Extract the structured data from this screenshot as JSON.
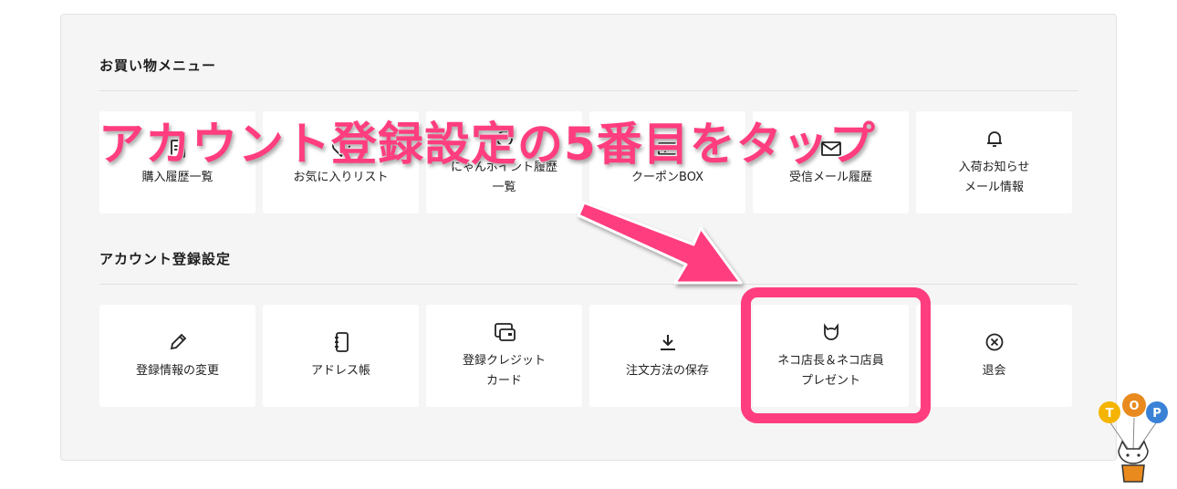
{
  "shopping_menu": {
    "title": "お買い物メニュー",
    "items": [
      {
        "label": "購入履歴一覧",
        "icon": "receipt-icon"
      },
      {
        "label": "お気に入りリスト",
        "icon": "heart-icon"
      },
      {
        "label": "にゃんポイント履歴\n一覧",
        "icon": "coin-icon"
      },
      {
        "label": "クーポンBOX",
        "icon": "coupon-icon"
      },
      {
        "label": "受信メール履歴",
        "icon": "envelope-icon"
      },
      {
        "label": "入荷お知らせ\nメール情報",
        "icon": "bell-icon"
      }
    ]
  },
  "account_settings": {
    "title": "アカウント登録設定",
    "items": [
      {
        "label": "登録情報の変更",
        "icon": "pencil-icon"
      },
      {
        "label": "アドレス帳",
        "icon": "address-book-icon"
      },
      {
        "label": "登録クレジット\nカード",
        "icon": "credit-card-icon"
      },
      {
        "label": "注文方法の保存",
        "icon": "download-icon"
      },
      {
        "label": "ネコ店長＆ネコ店員\nプレゼント",
        "icon": "cat-icon"
      },
      {
        "label": "退会",
        "icon": "close-circle-icon"
      }
    ]
  },
  "annotation": {
    "text": "アカウント登録設定の5番目をタップ",
    "color": "#ff3d7f"
  },
  "mascot": {
    "balloon_letters": [
      "T",
      "O",
      "P"
    ]
  }
}
